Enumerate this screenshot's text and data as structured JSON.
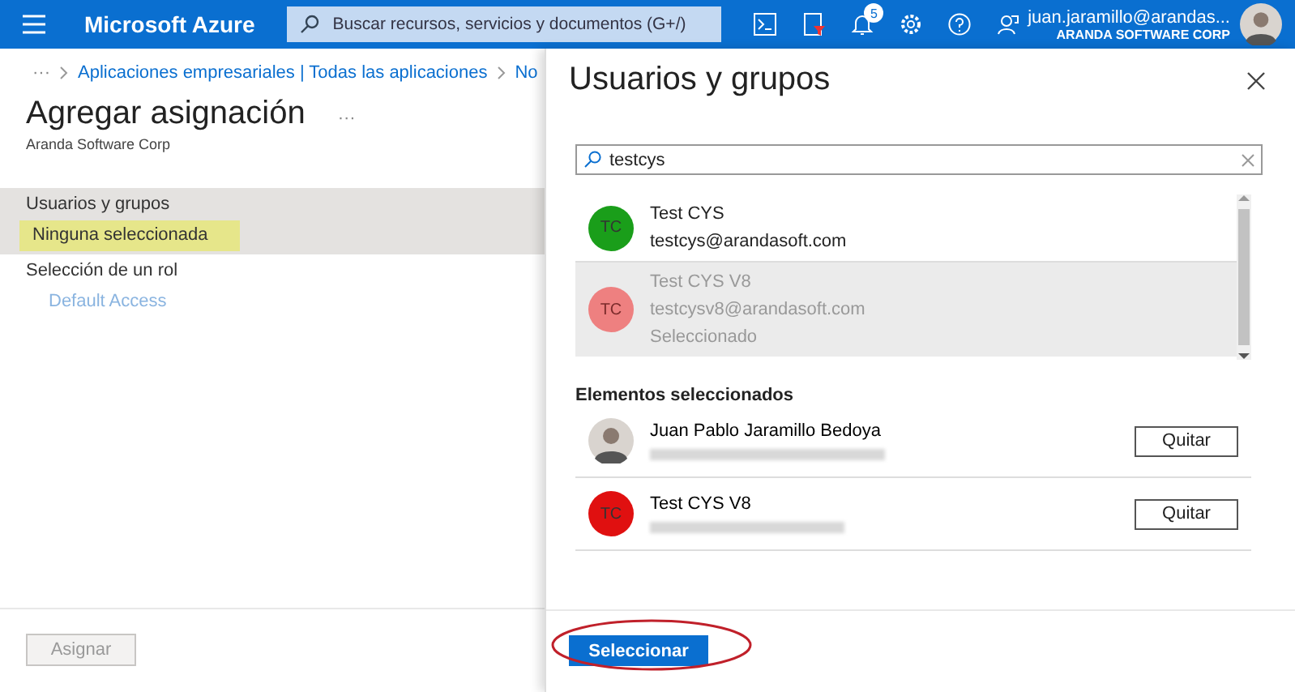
{
  "topbar": {
    "brand": "Microsoft Azure",
    "search_placeholder": "Buscar recursos, servicios y documentos (G+/)",
    "notification_count": "5",
    "account": "juan.jaramillo@arandas...",
    "organization": "ARANDA SOFTWARE CORP"
  },
  "breadcrumb": {
    "dots": "···",
    "items": [
      "Aplicaciones empresariales | Todas las aplicaciones",
      "No"
    ]
  },
  "page": {
    "title": "Agregar asignación",
    "more": "···",
    "subtitle": "Aranda Software Corp",
    "fields": [
      {
        "label": "Usuarios y grupos",
        "value": "Ninguna seleccionada",
        "highlighted": true
      },
      {
        "label": "Selección de un rol",
        "value": "Default Access",
        "highlighted": false
      }
    ],
    "assign_button": {
      "label": "Asignar",
      "disabled": true
    }
  },
  "panel": {
    "title": "Usuarios y grupos",
    "search_value": "testcys",
    "results": [
      {
        "initials": "TC",
        "name": "Test CYS",
        "email": "testcys@arandasoft.com",
        "color": "#1a9e1a",
        "selected": false
      },
      {
        "initials": "TC",
        "name": "Test CYS V8",
        "email": "testcysv8@arandasoft.com",
        "status": "Seleccionado",
        "color": "#ee8080",
        "selected": true
      }
    ],
    "selected_heading": "Elementos seleccionados",
    "selected_items": [
      {
        "kind": "photo",
        "name": "Juan Pablo Jaramillo Bedoya",
        "button": "Quitar"
      },
      {
        "kind": "initials",
        "initials": "TC",
        "color": "#e01010",
        "name": "Test CYS V8",
        "button": "Quitar"
      }
    ],
    "select_button": "Seleccionar"
  }
}
